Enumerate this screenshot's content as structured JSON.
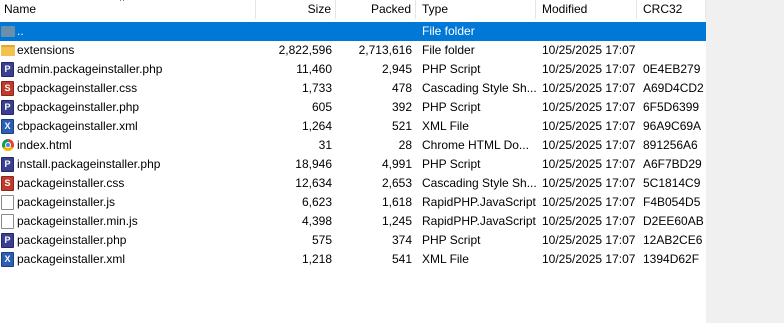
{
  "columns": {
    "name": "Name",
    "size": "Size",
    "packed": "Packed",
    "type": "Type",
    "modified": "Modified",
    "crc32": "CRC32"
  },
  "rows": [
    {
      "name": "..",
      "size": "",
      "packed": "",
      "type": "File folder",
      "modified": "",
      "crc32": "",
      "icon": "parent-folder-icon"
    },
    {
      "name": "extensions",
      "size": "2,822,596",
      "packed": "2,713,616",
      "type": "File folder",
      "modified": "10/25/2025 17:07",
      "crc32": "",
      "icon": "folder-icon"
    },
    {
      "name": "admin.packageinstaller.php",
      "size": "11,460",
      "packed": "2,945",
      "type": "PHP Script",
      "modified": "10/25/2025 17:07",
      "crc32": "0E4EB279",
      "icon": "php-file-icon"
    },
    {
      "name": "cbpackageinstaller.css",
      "size": "1,733",
      "packed": "478",
      "type": "Cascading Style Sh...",
      "modified": "10/25/2025 17:07",
      "crc32": "A69D4CD2",
      "icon": "css-file-icon"
    },
    {
      "name": "cbpackageinstaller.php",
      "size": "605",
      "packed": "392",
      "type": "PHP Script",
      "modified": "10/25/2025 17:07",
      "crc32": "6F5D6399",
      "icon": "php-file-icon"
    },
    {
      "name": "cbpackageinstaller.xml",
      "size": "1,264",
      "packed": "521",
      "type": "XML File",
      "modified": "10/25/2025 17:07",
      "crc32": "96A9C69A",
      "icon": "xml-file-icon"
    },
    {
      "name": "index.html",
      "size": "31",
      "packed": "28",
      "type": "Chrome HTML Do...",
      "modified": "10/25/2025 17:07",
      "crc32": "891256A6",
      "icon": "chrome-html-icon"
    },
    {
      "name": "install.packageinstaller.php",
      "size": "18,946",
      "packed": "4,991",
      "type": "PHP Script",
      "modified": "10/25/2025 17:07",
      "crc32": "A6F7BD29",
      "icon": "php-file-icon"
    },
    {
      "name": "packageinstaller.css",
      "size": "12,634",
      "packed": "2,653",
      "type": "Cascading Style Sh...",
      "modified": "10/25/2025 17:07",
      "crc32": "5C1814C9",
      "icon": "css-file-icon"
    },
    {
      "name": "packageinstaller.js",
      "size": "6,623",
      "packed": "1,618",
      "type": "RapidPHP.JavaScript",
      "modified": "10/25/2025 17:07",
      "crc32": "F4B054D5",
      "icon": "js-file-icon"
    },
    {
      "name": "packageinstaller.min.js",
      "size": "4,398",
      "packed": "1,245",
      "type": "RapidPHP.JavaScript",
      "modified": "10/25/2025 17:07",
      "crc32": "D2EE60AB",
      "icon": "js-file-icon"
    },
    {
      "name": "packageinstaller.php",
      "size": "575",
      "packed": "374",
      "type": "PHP Script",
      "modified": "10/25/2025 17:07",
      "crc32": "12AB2CE6",
      "icon": "php-file-icon"
    },
    {
      "name": "packageinstaller.xml",
      "size": "1,218",
      "packed": "541",
      "type": "XML File",
      "modified": "10/25/2025 17:07",
      "crc32": "1394D62F",
      "icon": "xml-file-icon"
    }
  ],
  "icon_glyphs": {
    "php-file-icon": "P",
    "css-file-icon": "S",
    "xml-file-icon": "X",
    "js-file-icon": "",
    "folder-icon": "",
    "parent-folder-icon": "",
    "chrome-html-icon": ""
  },
  "colors": {
    "selection": "#0078d7",
    "panel_background": "#f0f0f0",
    "list_background": "#ffffff"
  }
}
